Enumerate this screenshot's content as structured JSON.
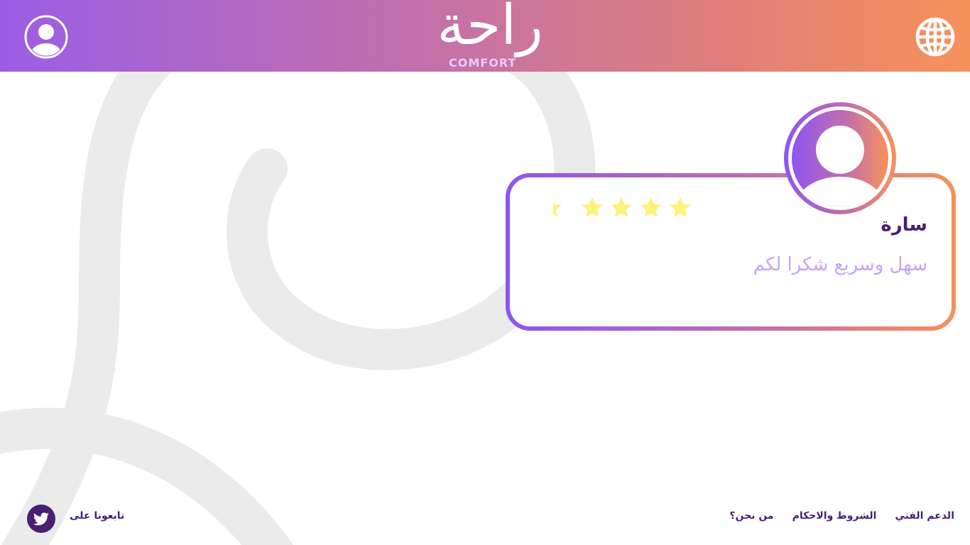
{
  "brand": {
    "name_ar": "راحة",
    "name_en": "COMFORT"
  },
  "header": {
    "user_icon": "user-circle-icon",
    "language_icon": "globe-icon"
  },
  "review": {
    "reviewer_name": "سارة",
    "text": "سهل وسريع شكرا لكم",
    "rating": 5,
    "rating_max": 5
  },
  "footer": {
    "links": [
      {
        "label": "الدعم الفني"
      },
      {
        "label": "الشروط والاحكام"
      },
      {
        "label": "من نحن؟"
      }
    ],
    "follow_label": "تابعونا على",
    "social_icon": "twitter-icon"
  },
  "colors": {
    "gradient_start": "#9b5de5",
    "gradient_end": "#f7915a",
    "text_dark": "#4a1f73",
    "text_light": "#c9a2f5",
    "star": "#fff27a",
    "swirl": "#ebebeb"
  }
}
